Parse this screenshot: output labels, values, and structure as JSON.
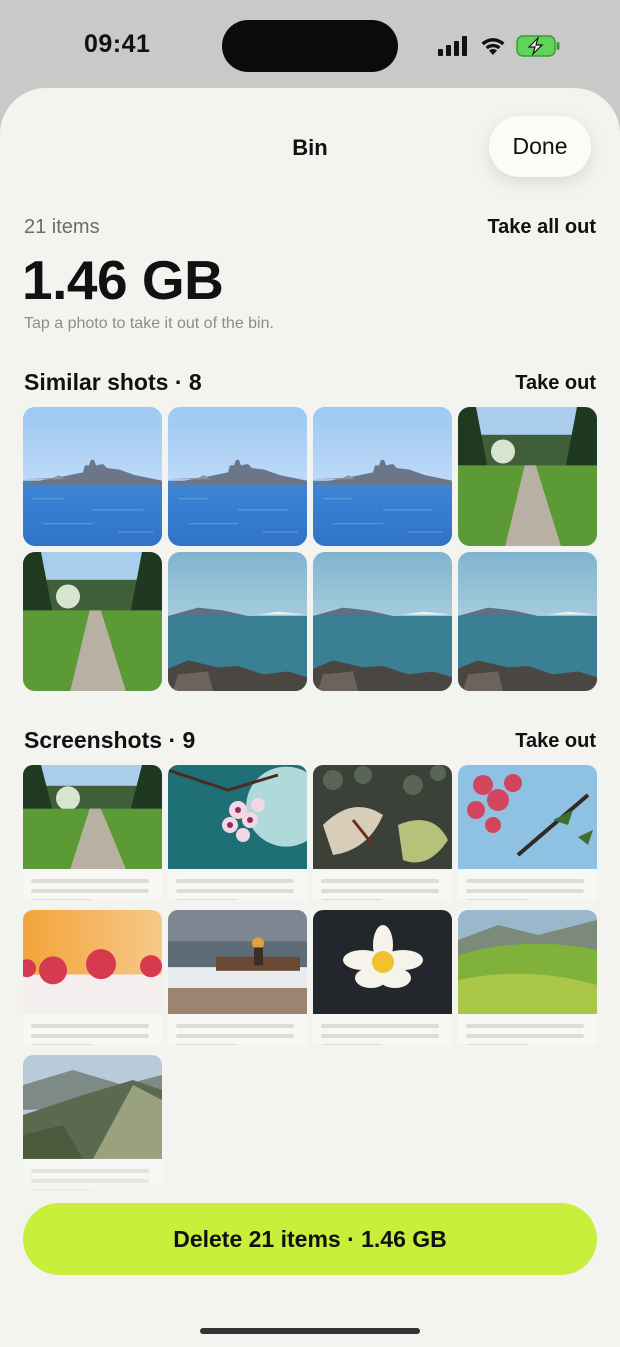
{
  "status_bar": {
    "time": "09:41"
  },
  "header": {
    "title": "Bin",
    "done_label": "Done"
  },
  "summary": {
    "items_count": "21 items",
    "take_all_label": "Take all out",
    "total_size": "1.46 GB",
    "hint": "Tap a photo to take it out of the bin."
  },
  "sections": [
    {
      "title": "Similar shots · 8",
      "action_label": "Take out",
      "photos": [
        "city-skyline",
        "city-skyline",
        "city-skyline",
        "park-path",
        "park-path",
        "coast-bay",
        "coast-bay",
        "coast-bay"
      ]
    },
    {
      "title": "Screenshots · 9",
      "action_label": "Take out",
      "photos": [
        "park-path",
        "cherry-blossom",
        "dried-leaves",
        "red-flowers",
        "raspberries",
        "lakeside-bench",
        "water-lily",
        "green-hills",
        "mountain-ridge"
      ]
    }
  ],
  "footer": {
    "delete_label": "Delete 21 items · 1.46 GB"
  },
  "colors": {
    "accent": "#c8ef3c",
    "background": "#f3f3f0"
  }
}
